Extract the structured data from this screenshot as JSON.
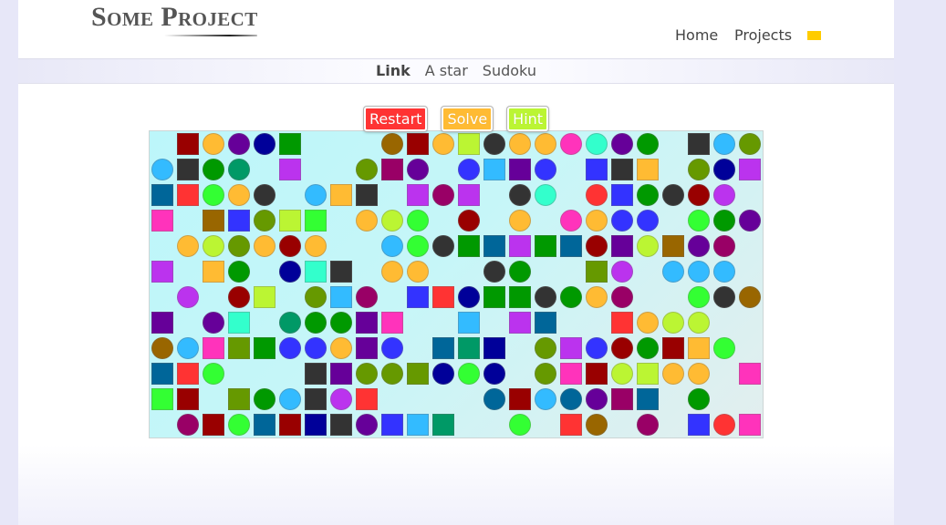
{
  "site": {
    "title": "Some Project"
  },
  "nav": {
    "items": [
      {
        "label": "Home"
      },
      {
        "label": "Projects"
      }
    ],
    "swatch_color": "#ffcc00"
  },
  "subnav": {
    "items": [
      {
        "label": "Link",
        "active": true
      },
      {
        "label": "A star",
        "active": false
      },
      {
        "label": "Sudoku",
        "active": false
      }
    ]
  },
  "controls": {
    "restart": {
      "label": "Restart",
      "color": "#ff3333"
    },
    "solve": {
      "label": "Solve",
      "color": "#ffbb33"
    },
    "hint": {
      "label": "Hint",
      "color": "#bbf533"
    }
  },
  "board": {
    "cells": [
      [
        null,
        [
          "square",
          "#990000"
        ],
        [
          "circle",
          "#ffbb33"
        ],
        [
          "circle",
          "#660099"
        ],
        [
          "circle",
          "#000099"
        ],
        [
          "square",
          "#009900"
        ],
        null,
        null,
        null,
        [
          "circle",
          "#996600"
        ],
        [
          "square",
          "#990000"
        ],
        [
          "circle",
          "#ffbb33"
        ],
        [
          "square",
          "#bbf533"
        ],
        [
          "circle",
          "#333333"
        ],
        [
          "circle",
          "#ffbb33"
        ],
        [
          "circle",
          "#ffbb33"
        ],
        [
          "circle",
          "#ff33bb"
        ],
        [
          "circle",
          "#33ffcc"
        ],
        [
          "circle",
          "#660099"
        ],
        [
          "circle",
          "#009900"
        ],
        null,
        [
          "square",
          "#333333"
        ],
        [
          "circle",
          "#33bbff"
        ],
        [
          "circle",
          "#669900"
        ]
      ],
      [
        [
          "circle",
          "#33bbff"
        ],
        [
          "square",
          "#333333"
        ],
        [
          "circle",
          "#009900"
        ],
        [
          "circle",
          "#009966"
        ],
        null,
        [
          "square",
          "#bb33ee"
        ],
        null,
        null,
        [
          "circle",
          "#669900"
        ],
        [
          "square",
          "#990066"
        ],
        [
          "circle",
          "#660099"
        ],
        null,
        [
          "circle",
          "#3333ff"
        ],
        [
          "square",
          "#33bbff"
        ],
        [
          "square",
          "#660099"
        ],
        [
          "circle",
          "#3333ff"
        ],
        null,
        [
          "square",
          "#3333ff"
        ],
        [
          "square",
          "#333333"
        ],
        [
          "square",
          "#ffbb33"
        ],
        null,
        [
          "circle",
          "#669900"
        ],
        [
          "circle",
          "#000099"
        ],
        [
          "square",
          "#bb33ee"
        ]
      ],
      [
        [
          "square",
          "#006699"
        ],
        [
          "square",
          "#ff3333"
        ],
        [
          "circle",
          "#33ff33"
        ],
        [
          "circle",
          "#ffbb33"
        ],
        [
          "circle",
          "#333333"
        ],
        null,
        [
          "circle",
          "#33bbff"
        ],
        [
          "square",
          "#ffbb33"
        ],
        [
          "square",
          "#333333"
        ],
        null,
        [
          "square",
          "#bb33ee"
        ],
        [
          "circle",
          "#990066"
        ],
        [
          "square",
          "#bb33ee"
        ],
        null,
        [
          "circle",
          "#333333"
        ],
        [
          "circle",
          "#33ffcc"
        ],
        null,
        [
          "circle",
          "#ff3333"
        ],
        [
          "square",
          "#3333ff"
        ],
        [
          "circle",
          "#009900"
        ],
        [
          "circle",
          "#333333"
        ],
        [
          "circle",
          "#990000"
        ],
        [
          "circle",
          "#bb33ee"
        ],
        null
      ],
      [
        [
          "square",
          "#ff33bb"
        ],
        null,
        [
          "square",
          "#996600"
        ],
        [
          "square",
          "#3333ff"
        ],
        [
          "circle",
          "#669900"
        ],
        [
          "square",
          "#bbf533"
        ],
        [
          "square",
          "#33ff33"
        ],
        null,
        [
          "circle",
          "#ffbb33"
        ],
        [
          "circle",
          "#bbf533"
        ],
        [
          "circle",
          "#33ff33"
        ],
        null,
        [
          "circle",
          "#990000"
        ],
        null,
        [
          "circle",
          "#ffbb33"
        ],
        null,
        [
          "circle",
          "#ff33bb"
        ],
        [
          "circle",
          "#ffbb33"
        ],
        [
          "circle",
          "#3333ff"
        ],
        [
          "circle",
          "#3333ff"
        ],
        null,
        [
          "circle",
          "#33ff33"
        ],
        [
          "circle",
          "#009900"
        ],
        [
          "circle",
          "#660099"
        ]
      ],
      [
        null,
        [
          "circle",
          "#ffbb33"
        ],
        [
          "circle",
          "#bbf533"
        ],
        [
          "circle",
          "#669900"
        ],
        [
          "circle",
          "#ffbb33"
        ],
        [
          "circle",
          "#990000"
        ],
        [
          "circle",
          "#ffbb33"
        ],
        null,
        null,
        [
          "circle",
          "#33bbff"
        ],
        [
          "circle",
          "#33ff33"
        ],
        [
          "circle",
          "#333333"
        ],
        [
          "square",
          "#009900"
        ],
        [
          "square",
          "#006699"
        ],
        [
          "square",
          "#bb33ee"
        ],
        [
          "square",
          "#009900"
        ],
        [
          "square",
          "#006699"
        ],
        [
          "circle",
          "#990000"
        ],
        [
          "square",
          "#660099"
        ],
        [
          "circle",
          "#bbf533"
        ],
        [
          "square",
          "#996600"
        ],
        [
          "circle",
          "#660099"
        ],
        [
          "circle",
          "#990066"
        ],
        null
      ],
      [
        [
          "square",
          "#bb33ee"
        ],
        null,
        [
          "square",
          "#ffbb33"
        ],
        [
          "circle",
          "#009900"
        ],
        null,
        [
          "circle",
          "#000099"
        ],
        [
          "square",
          "#33ffcc"
        ],
        [
          "square",
          "#333333"
        ],
        null,
        [
          "circle",
          "#ffbb33"
        ],
        [
          "circle",
          "#ffbb33"
        ],
        null,
        null,
        [
          "circle",
          "#333333"
        ],
        [
          "circle",
          "#009900"
        ],
        null,
        null,
        [
          "square",
          "#669900"
        ],
        [
          "circle",
          "#bb33ee"
        ],
        null,
        [
          "circle",
          "#33bbff"
        ],
        [
          "circle",
          "#33bbff"
        ],
        [
          "circle",
          "#33bbff"
        ],
        null
      ],
      [
        null,
        [
          "circle",
          "#bb33ee"
        ],
        null,
        [
          "circle",
          "#990000"
        ],
        [
          "square",
          "#bbf533"
        ],
        null,
        [
          "circle",
          "#669900"
        ],
        [
          "square",
          "#33bbff"
        ],
        [
          "circle",
          "#990066"
        ],
        null,
        [
          "square",
          "#3333ff"
        ],
        [
          "square",
          "#ff3333"
        ],
        [
          "circle",
          "#000099"
        ],
        [
          "square",
          "#009900"
        ],
        [
          "square",
          "#009900"
        ],
        [
          "circle",
          "#333333"
        ],
        [
          "circle",
          "#009900"
        ],
        [
          "circle",
          "#ffbb33"
        ],
        [
          "circle",
          "#990066"
        ],
        null,
        null,
        [
          "circle",
          "#33ff33"
        ],
        [
          "circle",
          "#333333"
        ],
        [
          "circle",
          "#996600"
        ]
      ],
      [
        [
          "square",
          "#660099"
        ],
        null,
        [
          "circle",
          "#660099"
        ],
        [
          "square",
          "#33ffcc"
        ],
        null,
        [
          "circle",
          "#009966"
        ],
        [
          "circle",
          "#009900"
        ],
        [
          "circle",
          "#009900"
        ],
        [
          "square",
          "#660099"
        ],
        [
          "square",
          "#ff33bb"
        ],
        null,
        null,
        [
          "square",
          "#33bbff"
        ],
        null,
        [
          "square",
          "#bb33ee"
        ],
        [
          "square",
          "#006699"
        ],
        null,
        null,
        [
          "square",
          "#ff3333"
        ],
        [
          "circle",
          "#ffbb33"
        ],
        [
          "circle",
          "#bbf533"
        ],
        [
          "circle",
          "#bbf533"
        ],
        null,
        null
      ],
      [
        [
          "circle",
          "#996600"
        ],
        [
          "circle",
          "#33bbff"
        ],
        [
          "square",
          "#ff33bb"
        ],
        [
          "square",
          "#669900"
        ],
        [
          "square",
          "#009900"
        ],
        [
          "circle",
          "#3333ff"
        ],
        [
          "circle",
          "#3333ff"
        ],
        [
          "circle",
          "#ffbb33"
        ],
        [
          "square",
          "#660099"
        ],
        [
          "circle",
          "#3333ff"
        ],
        null,
        [
          "square",
          "#006699"
        ],
        [
          "square",
          "#009966"
        ],
        [
          "square",
          "#000099"
        ],
        null,
        [
          "circle",
          "#669900"
        ],
        [
          "square",
          "#bb33ee"
        ],
        [
          "circle",
          "#3333ff"
        ],
        [
          "circle",
          "#990000"
        ],
        [
          "circle",
          "#009900"
        ],
        [
          "square",
          "#990000"
        ],
        [
          "square",
          "#ffbb33"
        ],
        [
          "circle",
          "#33ff33"
        ],
        null
      ],
      [
        [
          "square",
          "#006699"
        ],
        [
          "square",
          "#ff3333"
        ],
        [
          "circle",
          "#33ff33"
        ],
        null,
        null,
        null,
        [
          "square",
          "#333333"
        ],
        [
          "square",
          "#660099"
        ],
        [
          "circle",
          "#669900"
        ],
        [
          "circle",
          "#669900"
        ],
        [
          "square",
          "#669900"
        ],
        [
          "circle",
          "#000099"
        ],
        [
          "circle",
          "#33ff33"
        ],
        [
          "circle",
          "#000099"
        ],
        null,
        [
          "circle",
          "#669900"
        ],
        [
          "square",
          "#ff33bb"
        ],
        [
          "square",
          "#990000"
        ],
        [
          "circle",
          "#bbf533"
        ],
        [
          "square",
          "#bbf533"
        ],
        [
          "circle",
          "#ffbb33"
        ],
        [
          "circle",
          "#ffbb33"
        ],
        null,
        [
          "square",
          "#ff33bb"
        ]
      ],
      [
        [
          "square",
          "#33ff33"
        ],
        [
          "square",
          "#990000"
        ],
        null,
        [
          "square",
          "#669900"
        ],
        [
          "circle",
          "#009900"
        ],
        [
          "circle",
          "#33bbff"
        ],
        [
          "square",
          "#333333"
        ],
        [
          "circle",
          "#bb33ee"
        ],
        [
          "square",
          "#ff3333"
        ],
        null,
        null,
        null,
        null,
        [
          "circle",
          "#006699"
        ],
        [
          "square",
          "#990000"
        ],
        [
          "circle",
          "#33bbff"
        ],
        [
          "circle",
          "#006699"
        ],
        [
          "circle",
          "#660099"
        ],
        [
          "square",
          "#990066"
        ],
        [
          "square",
          "#006699"
        ],
        null,
        [
          "circle",
          "#009900"
        ],
        null,
        null
      ],
      [
        null,
        [
          "circle",
          "#990066"
        ],
        [
          "square",
          "#990000"
        ],
        [
          "circle",
          "#33ff33"
        ],
        [
          "square",
          "#006699"
        ],
        [
          "square",
          "#990000"
        ],
        [
          "square",
          "#000099"
        ],
        [
          "square",
          "#333333"
        ],
        [
          "circle",
          "#660099"
        ],
        [
          "square",
          "#3333ff"
        ],
        [
          "square",
          "#33bbff"
        ],
        [
          "square",
          "#009966"
        ],
        null,
        null,
        [
          "circle",
          "#33ff33"
        ],
        null,
        [
          "square",
          "#ff3333"
        ],
        [
          "circle",
          "#996600"
        ],
        null,
        [
          "circle",
          "#990066"
        ],
        null,
        [
          "square",
          "#3333ff"
        ],
        [
          "circle",
          "#ff3333"
        ],
        [
          "square",
          "#ff33bb"
        ]
      ]
    ]
  }
}
